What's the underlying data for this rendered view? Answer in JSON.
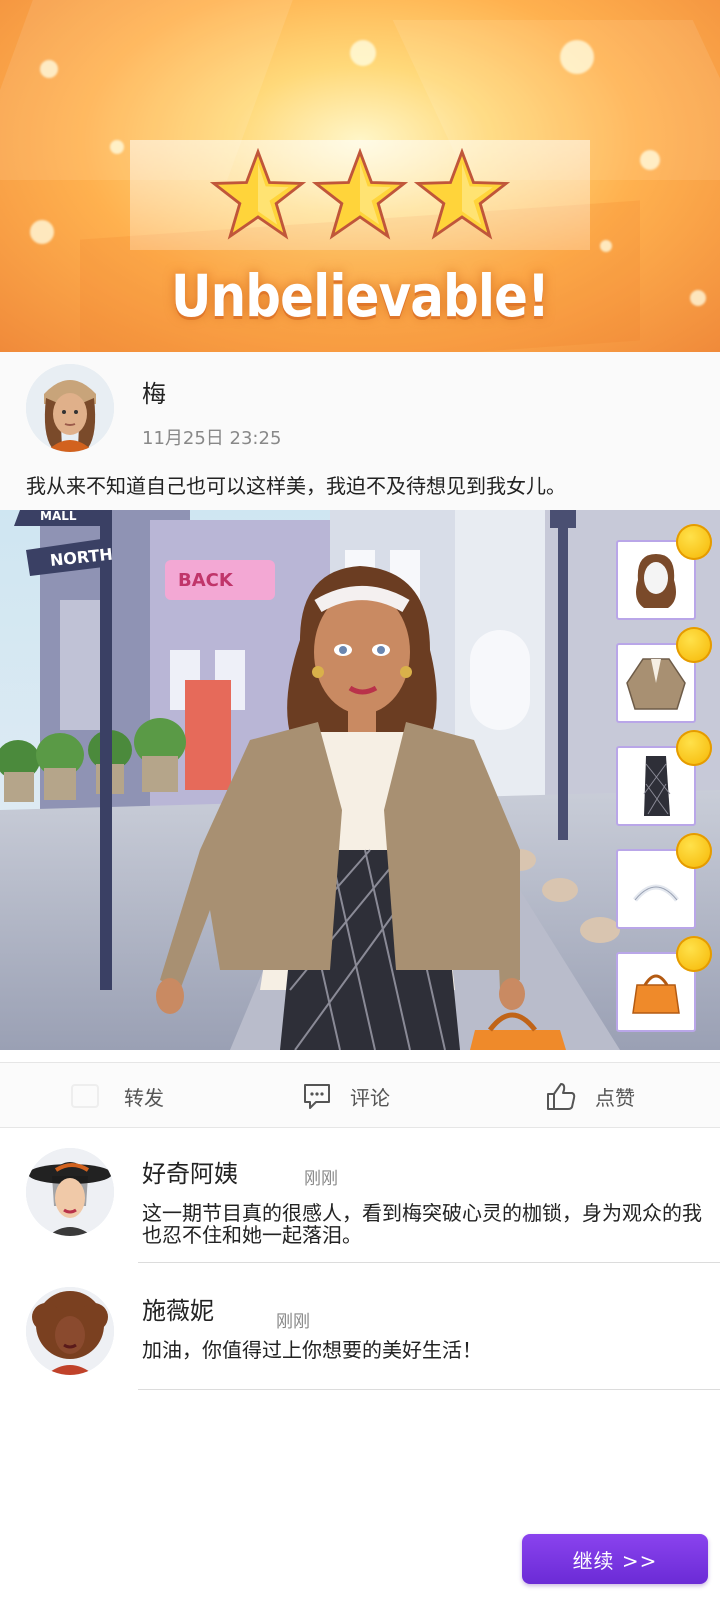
{
  "banner": {
    "title": "Unbelievable!",
    "stars": 3,
    "stars_max": 3
  },
  "post": {
    "author": "梅",
    "time": "11月25日 23:25",
    "text": "我从来不知道自己也可以这样美，我迫不及待想见到我女儿。"
  },
  "scene": {
    "signs": [
      "MALL",
      "NORTH"
    ],
    "shop_sign": "BACK",
    "items": [
      {
        "name": "hair",
        "icon": "hair-item-icon"
      },
      {
        "name": "jacket",
        "icon": "jacket-item-icon"
      },
      {
        "name": "skirt",
        "icon": "skirt-item-icon"
      },
      {
        "name": "headband",
        "icon": "headband-item-icon"
      },
      {
        "name": "handbag",
        "icon": "handbag-item-icon"
      }
    ]
  },
  "actions": {
    "share_label": "转发",
    "comment_label": "评论",
    "like_label": "点赞"
  },
  "comments": [
    {
      "name": "好奇阿姨",
      "time": "刚刚",
      "text": "这一期节目真的很感人，看到梅突破心灵的枷锁，身为观众的我也忍不住和她一起落泪。"
    },
    {
      "name": "施薇妮",
      "time": "刚刚",
      "text": "加油，你值得过上你想要的美好生活！"
    }
  ],
  "continue_label": "继续 >>",
  "colors": {
    "accent": "#7a35e4",
    "item_border": "#b9a6e8",
    "banner": "#ffb14f"
  }
}
